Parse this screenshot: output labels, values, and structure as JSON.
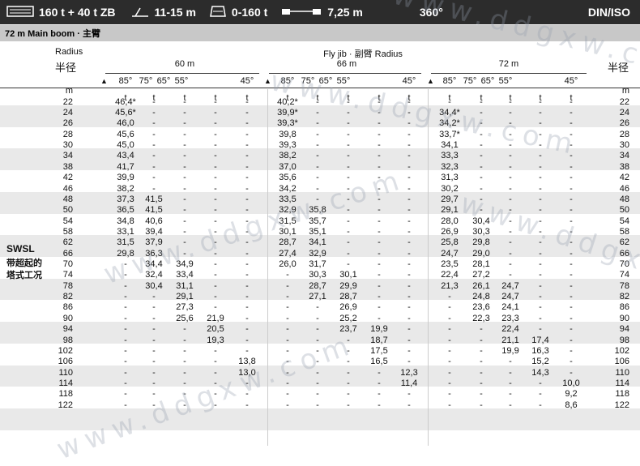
{
  "topbar": {
    "capacity": "160 t + 40 t ZB",
    "boom_range": "11-15 m",
    "counterweight": "0-160 t",
    "width": "7,25 m",
    "slewing": "360°",
    "standard": "DIN/ISO"
  },
  "subheader": "72 m  Main boom · 主臂",
  "header": {
    "radius_label": "Radius",
    "radius_cn": "半径",
    "flyjib_label": "Fly jib · 副臂 Radius",
    "radius_cn_right": "半径",
    "units_row": "t",
    "radius_unit": "m"
  },
  "groups": [
    {
      "jib_length": "60 m",
      "angles": [
        "85°",
        "75°",
        "65°",
        "55°",
        "45°"
      ]
    },
    {
      "jib_length": "66 m",
      "angles": [
        "85°",
        "75°",
        "65°",
        "55°",
        "45°"
      ]
    },
    {
      "jib_length": "72 m",
      "angles": [
        "85°",
        "75°",
        "65°",
        "55°",
        "45°"
      ]
    }
  ],
  "sidebar": {
    "code": "SWSL",
    "desc_line1": "带超起的",
    "desc_line2": "塔式工况"
  },
  "watermark": "www.ddgxw.com",
  "rows": [
    {
      "r": "22",
      "v": [
        "46,4*",
        "-",
        "-",
        "-",
        "-",
        "40,2*",
        "-",
        "-",
        "-",
        "-",
        "-",
        "-",
        "-",
        "-",
        "-"
      ]
    },
    {
      "r": "24",
      "v": [
        "45,6*",
        "-",
        "-",
        "-",
        "-",
        "39,9*",
        "-",
        "-",
        "-",
        "-",
        "34,4*",
        "-",
        "-",
        "-",
        "-"
      ]
    },
    {
      "r": "26",
      "v": [
        "46,0",
        "-",
        "-",
        "-",
        "-",
        "39,3*",
        "-",
        "-",
        "-",
        "-",
        "34,2*",
        "-",
        "-",
        "-",
        "-"
      ]
    },
    {
      "r": "28",
      "v": [
        "45,6",
        "-",
        "-",
        "-",
        "-",
        "39,8",
        "-",
        "-",
        "-",
        "-",
        "33,7*",
        "-",
        "-",
        "-",
        "-"
      ]
    },
    {
      "r": "30",
      "v": [
        "45,0",
        "-",
        "-",
        "-",
        "-",
        "39,3",
        "-",
        "-",
        "-",
        "-",
        "34,1",
        "-",
        "-",
        "-",
        "-"
      ]
    },
    {
      "r": "34",
      "v": [
        "43,4",
        "-",
        "-",
        "-",
        "-",
        "38,2",
        "-",
        "-",
        "-",
        "-",
        "33,3",
        "-",
        "-",
        "-",
        "-"
      ]
    },
    {
      "r": "38",
      "v": [
        "41,7",
        "-",
        "-",
        "-",
        "-",
        "37,0",
        "-",
        "-",
        "-",
        "-",
        "32,3",
        "-",
        "-",
        "-",
        "-"
      ]
    },
    {
      "r": "42",
      "v": [
        "39,9",
        "-",
        "-",
        "-",
        "-",
        "35,6",
        "-",
        "-",
        "-",
        "-",
        "31,3",
        "-",
        "-",
        "-",
        "-"
      ]
    },
    {
      "r": "46",
      "v": [
        "38,2",
        "-",
        "-",
        "-",
        "-",
        "34,2",
        "-",
        "-",
        "-",
        "-",
        "30,2",
        "-",
        "-",
        "-",
        "-"
      ]
    },
    {
      "r": "48",
      "v": [
        "37,3",
        "41,5",
        "-",
        "-",
        "-",
        "33,5",
        "-",
        "-",
        "-",
        "-",
        "29,7",
        "-",
        "-",
        "-",
        "-"
      ]
    },
    {
      "r": "50",
      "v": [
        "36,5",
        "41,5",
        "-",
        "-",
        "-",
        "32,9",
        "35,8",
        "-",
        "-",
        "-",
        "29,1",
        "-",
        "-",
        "-",
        "-"
      ]
    },
    {
      "r": "54",
      "v": [
        "34,8",
        "40,6",
        "-",
        "-",
        "-",
        "31,5",
        "35,7",
        "-",
        "-",
        "-",
        "28,0",
        "30,4",
        "-",
        "-",
        "-"
      ]
    },
    {
      "r": "58",
      "v": [
        "33,1",
        "39,4",
        "-",
        "-",
        "-",
        "30,1",
        "35,1",
        "-",
        "-",
        "-",
        "26,9",
        "30,3",
        "-",
        "-",
        "-"
      ]
    },
    {
      "r": "62",
      "v": [
        "31,5",
        "37,9",
        "-",
        "-",
        "-",
        "28,7",
        "34,1",
        "-",
        "-",
        "-",
        "25,8",
        "29,8",
        "-",
        "-",
        "-"
      ]
    },
    {
      "r": "66",
      "v": [
        "29,8",
        "36,3",
        "-",
        "-",
        "-",
        "27,4",
        "32,9",
        "-",
        "-",
        "-",
        "24,7",
        "29,0",
        "-",
        "-",
        "-"
      ]
    },
    {
      "r": "70",
      "v": [
        "-",
        "34,4",
        "34,9",
        "-",
        "-",
        "26,0",
        "31,7",
        "-",
        "-",
        "-",
        "23,5",
        "28,1",
        "-",
        "-",
        "-"
      ]
    },
    {
      "r": "74",
      "v": [
        "-",
        "32,4",
        "33,4",
        "-",
        "-",
        "-",
        "30,3",
        "30,1",
        "-",
        "-",
        "22,4",
        "27,2",
        "-",
        "-",
        "-"
      ]
    },
    {
      "r": "78",
      "v": [
        "-",
        "30,4",
        "31,1",
        "-",
        "-",
        "-",
        "28,7",
        "29,9",
        "-",
        "-",
        "21,3",
        "26,1",
        "24,7",
        "-",
        "-"
      ]
    },
    {
      "r": "82",
      "v": [
        "-",
        "-",
        "29,1",
        "-",
        "-",
        "-",
        "27,1",
        "28,7",
        "-",
        "-",
        "-",
        "24,8",
        "24,7",
        "-",
        "-"
      ]
    },
    {
      "r": "86",
      "v": [
        "-",
        "-",
        "27,3",
        "-",
        "-",
        "-",
        "-",
        "26,9",
        "-",
        "-",
        "-",
        "23,6",
        "24,1",
        "-",
        "-"
      ]
    },
    {
      "r": "90",
      "v": [
        "-",
        "-",
        "25,6",
        "21,9",
        "-",
        "-",
        "-",
        "25,2",
        "-",
        "-",
        "-",
        "22,3",
        "23,3",
        "-",
        "-"
      ]
    },
    {
      "r": "94",
      "v": [
        "-",
        "-",
        "-",
        "20,5",
        "-",
        "-",
        "-",
        "23,7",
        "19,9",
        "-",
        "-",
        "-",
        "22,4",
        "-",
        "-"
      ]
    },
    {
      "r": "98",
      "v": [
        "-",
        "-",
        "-",
        "19,3",
        "-",
        "-",
        "-",
        "-",
        "18,7",
        "-",
        "-",
        "-",
        "21,1",
        "17,4",
        "-"
      ]
    },
    {
      "r": "102",
      "v": [
        "-",
        "-",
        "-",
        "-",
        "-",
        "-",
        "-",
        "-",
        "17,5",
        "-",
        "-",
        "-",
        "19,9",
        "16,3",
        "-"
      ]
    },
    {
      "r": "106",
      "v": [
        "-",
        "-",
        "-",
        "-",
        "13,8",
        "-",
        "-",
        "-",
        "16,5",
        "-",
        "-",
        "-",
        "-",
        "15,2",
        "-"
      ]
    },
    {
      "r": "110",
      "v": [
        "-",
        "-",
        "-",
        "-",
        "13,0",
        "-",
        "-",
        "-",
        "-",
        "12,3",
        "-",
        "-",
        "-",
        "14,3",
        "-"
      ]
    },
    {
      "r": "114",
      "v": [
        "-",
        "-",
        "-",
        "-",
        "-",
        "-",
        "-",
        "-",
        "-",
        "11,4",
        "-",
        "-",
        "-",
        "-",
        "10,0"
      ]
    },
    {
      "r": "118",
      "v": [
        "-",
        "-",
        "-",
        "-",
        "-",
        "-",
        "-",
        "-",
        "-",
        "-",
        "-",
        "-",
        "-",
        "-",
        "9,2"
      ]
    },
    {
      "r": "122",
      "v": [
        "-",
        "-",
        "-",
        "-",
        "-",
        "-",
        "-",
        "-",
        "-",
        "-",
        "-",
        "-",
        "-",
        "-",
        "8,6"
      ]
    }
  ]
}
